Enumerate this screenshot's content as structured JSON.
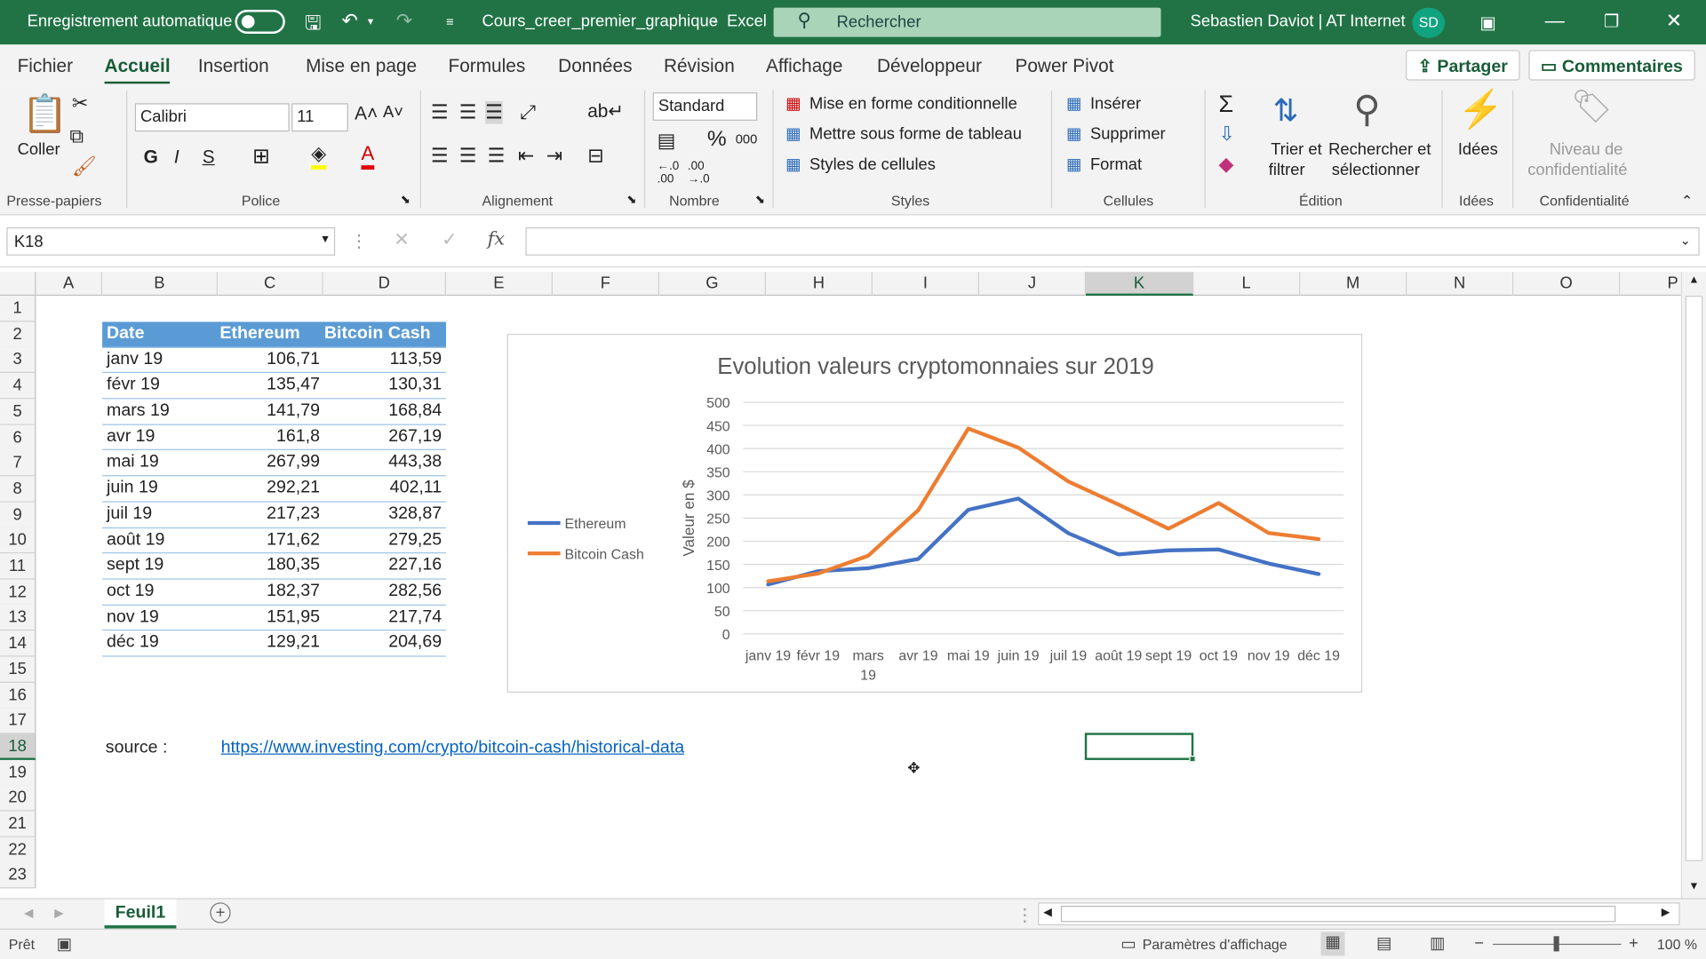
{
  "titlebar": {
    "autosave": "Enregistrement automatique",
    "filename": "Cours_creer_premier_graphique",
    "separator": "-",
    "app": "Excel",
    "search_placeholder": "Rechercher",
    "user": "Sebastien Daviot | AT Internet",
    "initials": "SD"
  },
  "menu": {
    "items": [
      "Fichier",
      "Accueil",
      "Insertion",
      "Mise en page",
      "Formules",
      "Données",
      "Révision",
      "Affichage",
      "Développeur",
      "Power Pivot"
    ],
    "share": "Partager",
    "comments": "Commentaires"
  },
  "ribbon": {
    "paste": "Coller",
    "clipboard_group": "Presse-papiers",
    "font_name": "Calibri",
    "font_size": "11",
    "bold": "G",
    "italic": "I",
    "underline": "S",
    "font_group": "Police",
    "align_group": "Alignement",
    "number_format": "Standard",
    "number_group": "Nombre",
    "percent": "%",
    "thousands": "000",
    "cond_format": "Mise en forme conditionnelle",
    "table_format": "Mettre sous forme de tableau",
    "cell_styles": "Styles de cellules",
    "styles_group": "Styles",
    "insert": "Insérer",
    "delete": "Supprimer",
    "format": "Format",
    "cells_group": "Cellules",
    "sort1": "Trier et",
    "sort2": "filtrer",
    "find1": "Rechercher et",
    "find2": "sélectionner",
    "edit_group": "Édition",
    "ideas": "Idées",
    "ideas_group": "Idées",
    "conf1": "Niveau de",
    "conf2": "confidentialité",
    "conf_group": "Confidentialité"
  },
  "formula_bar": {
    "name_box": "K18",
    "cancel": "✕",
    "enter": "✓",
    "fx": "fx",
    "value": ""
  },
  "columns": [
    "A",
    "B",
    "C",
    "D",
    "E",
    "F",
    "G",
    "H",
    "I",
    "J",
    "K",
    "L",
    "M",
    "N",
    "O",
    "P"
  ],
  "rows": [
    "1",
    "2",
    "3",
    "4",
    "5",
    "6",
    "7",
    "8",
    "9",
    "10",
    "11",
    "12",
    "13",
    "14",
    "15",
    "16",
    "17",
    "18",
    "19",
    "20",
    "21",
    "22",
    "23"
  ],
  "table": {
    "headers": [
      "Date",
      "Ethereum",
      "Bitcoin Cash"
    ],
    "rows": [
      [
        "janv 19",
        "106,71",
        "113,59"
      ],
      [
        "févr 19",
        "135,47",
        "130,31"
      ],
      [
        "mars 19",
        "141,79",
        "168,84"
      ],
      [
        "avr 19",
        "161,8",
        "267,19"
      ],
      [
        "mai 19",
        "267,99",
        "443,38"
      ],
      [
        "juin 19",
        "292,21",
        "402,11"
      ],
      [
        "juil 19",
        "217,23",
        "328,87"
      ],
      [
        "août 19",
        "171,62",
        "279,25"
      ],
      [
        "sept 19",
        "180,35",
        "227,16"
      ],
      [
        "oct 19",
        "182,37",
        "282,56"
      ],
      [
        "nov 19",
        "151,95",
        "217,74"
      ],
      [
        "déc 19",
        "129,21",
        "204,69"
      ]
    ]
  },
  "source": {
    "label": "source :",
    "url": "https://www.investing.com/crypto/bitcoin-cash/historical-data"
  },
  "chart_data": {
    "type": "line",
    "title": "Evolution valeurs cryptomonnaies sur 2019",
    "ylabel": "Valeur en $",
    "xlabel": "",
    "ylim": [
      0,
      500
    ],
    "yticks": [
      0,
      50,
      100,
      150,
      200,
      250,
      300,
      350,
      400,
      450,
      500
    ],
    "legend": "left",
    "grid": true,
    "categories": [
      "janv 19",
      "févr 19",
      "mars 19",
      "avr 19",
      "mai 19",
      "juin 19",
      "juil 19",
      "août 19",
      "sept 19",
      "oct 19",
      "nov 19",
      "déc 19"
    ],
    "series": [
      {
        "name": "Ethereum",
        "color": "#4472c4",
        "values": [
          106.71,
          135.47,
          141.79,
          161.8,
          267.99,
          292.21,
          217.23,
          171.62,
          180.35,
          182.37,
          151.95,
          129.21
        ]
      },
      {
        "name": "Bitcoin Cash",
        "color": "#ed7d31",
        "values": [
          113.59,
          130.31,
          168.84,
          267.19,
          443.38,
          402.11,
          328.87,
          279.25,
          227.16,
          282.56,
          217.74,
          204.69
        ]
      }
    ]
  },
  "sheets": {
    "active": "Feuil1",
    "add": "+"
  },
  "status": {
    "ready": "Prêt",
    "display_settings": "Paramètres d'affichage",
    "zoom": "100 %"
  },
  "colors": {
    "excel_green": "#217346",
    "table_header": "#5b9bd5"
  }
}
